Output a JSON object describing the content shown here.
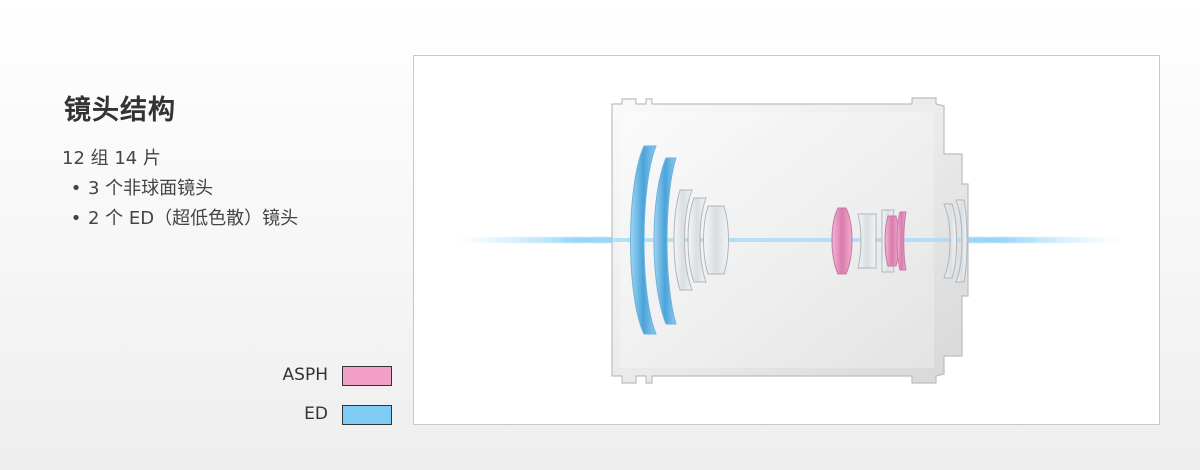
{
  "heading": "镜头结构",
  "specs": {
    "groups_elements": "12 组 14 片",
    "bullet": "•",
    "items": [
      "3 个非球面镜头",
      "2 个 ED（超低色散）镜头"
    ]
  },
  "legend": [
    {
      "label": "ASPH",
      "color": "#f29ec6"
    },
    {
      "label": "ED",
      "color": "#7ecbf4"
    }
  ],
  "colors": {
    "asph": "#e58ab8",
    "ed": "#63b4e2",
    "glass": "#e4e7ea",
    "barrel": "#e6e6e6",
    "axis_light": "#8fd2f6"
  }
}
